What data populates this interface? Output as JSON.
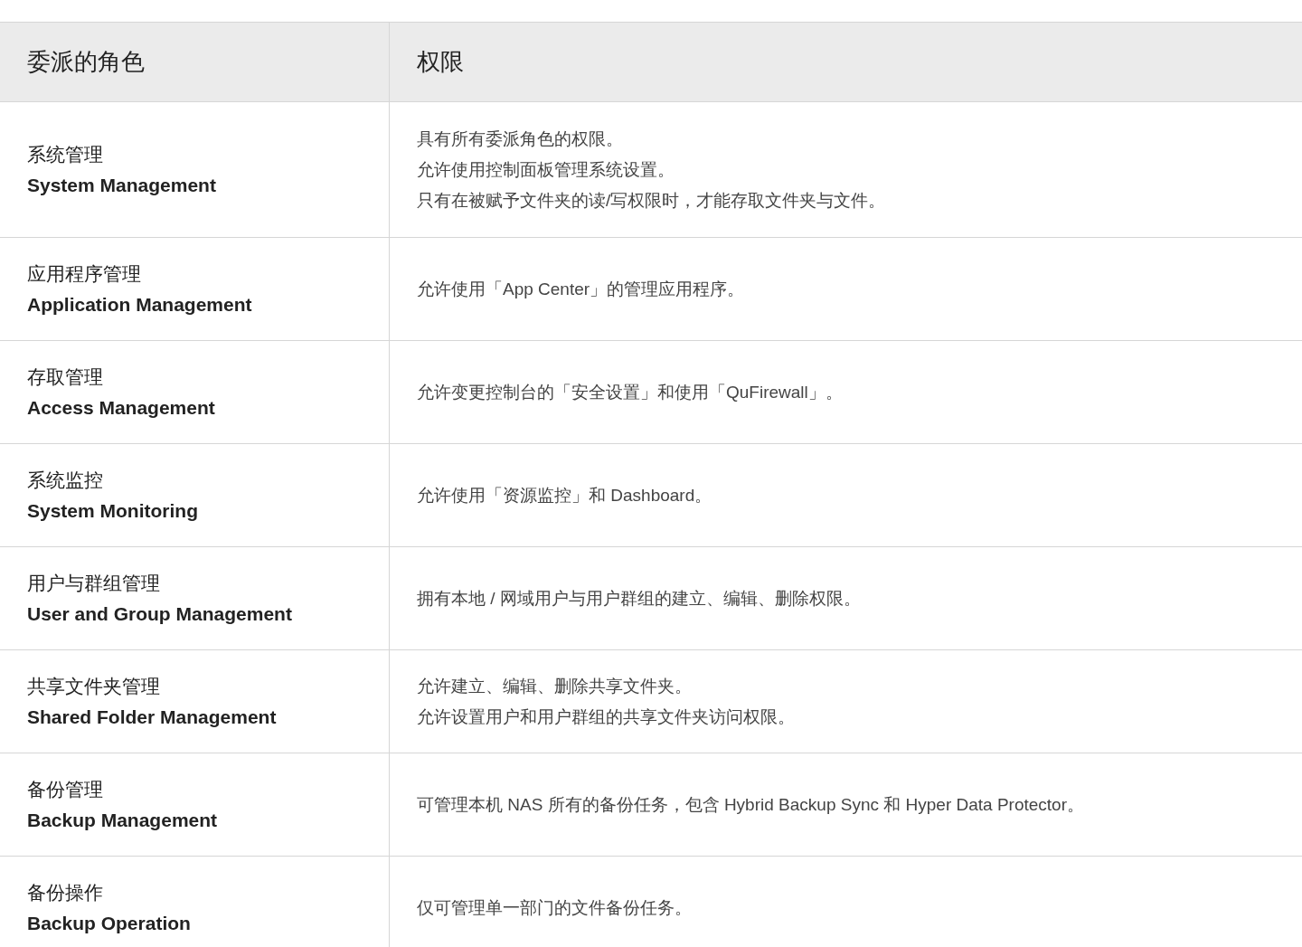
{
  "table": {
    "columns": [
      "委派的角色",
      "权限"
    ],
    "rows": [
      {
        "role_zh": "系统管理",
        "role_en": "System Management",
        "permissions": [
          "具有所有委派角色的权限。",
          "允许使用控制面板管理系统设置。",
          "只有在被赋予文件夹的读/写权限时，才能存取文件夹与文件。"
        ]
      },
      {
        "role_zh": "应用程序管理",
        "role_en": "Application Management",
        "permissions": [
          "允许使用「App Center」的管理应用程序。"
        ]
      },
      {
        "role_zh": "存取管理",
        "role_en": "Access Management",
        "permissions": [
          "允许变更控制台的「安全设置」和使用「QuFirewall」。"
        ]
      },
      {
        "role_zh": "系统监控",
        "role_en": "System Monitoring",
        "permissions": [
          "允许使用「资源监控」和 Dashboard。"
        ]
      },
      {
        "role_zh": "用户与群组管理",
        "role_en": "User and Group Management",
        "permissions": [
          "拥有本地 / 网域用户与用户群组的建立、编辑、删除权限。"
        ]
      },
      {
        "role_zh": "共享文件夹管理",
        "role_en": "Shared Folder Management",
        "permissions": [
          "允许建立、编辑、删除共享文件夹。",
          "允许设置用户和用户群组的共享文件夹访问权限。"
        ]
      },
      {
        "role_zh": "备份管理",
        "role_en": "Backup Management",
        "permissions": [
          "可管理本机 NAS 所有的备份任务，包含 Hybrid Backup Sync 和 Hyper Data Protector。"
        ]
      },
      {
        "role_zh": "备份操作",
        "role_en": "Backup Operation",
        "permissions": [
          "仅可管理单一部门的文件备份任务。"
        ]
      }
    ]
  }
}
